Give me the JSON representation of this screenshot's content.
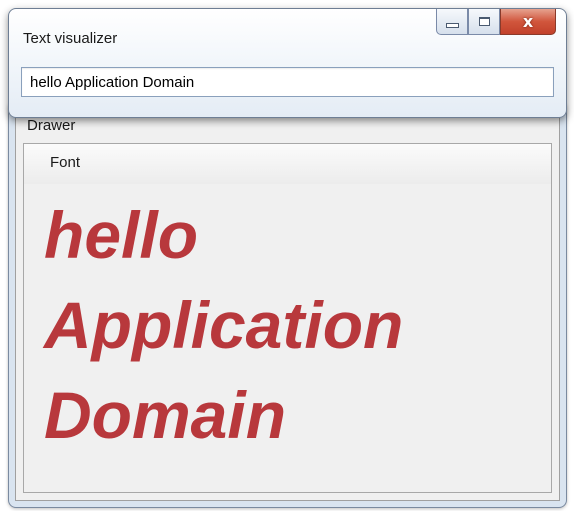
{
  "visualizer": {
    "title": "Text visualizer",
    "input_value": "hello Application Domain",
    "buttons": {
      "minimize_icon": "minimize-icon",
      "maximize_icon": "maximize-icon",
      "close_icon": "close-icon",
      "close_glyph": "x"
    }
  },
  "drawer": {
    "title": "Drawer",
    "font_label": "Font",
    "sample_lines": [
      "hello",
      "Application",
      "Domain"
    ],
    "sample_color": "#b8383c"
  }
}
